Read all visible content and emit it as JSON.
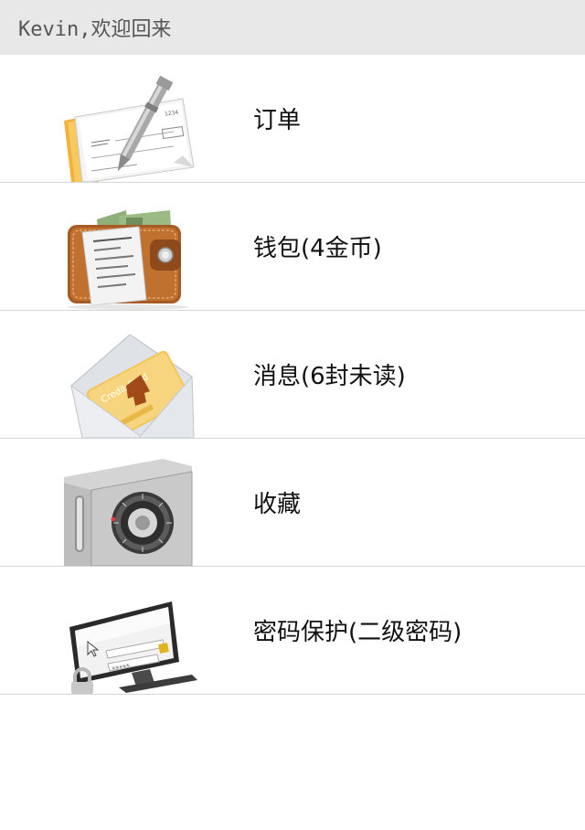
{
  "header": {
    "title": "Kevin,欢迎回来"
  },
  "menu": {
    "items": [
      {
        "label": "订单",
        "icon": "check-order-icon"
      },
      {
        "label": "钱包(4金币)",
        "icon": "wallet-icon"
      },
      {
        "label": "消息(6封未读)",
        "icon": "envelope-icon"
      },
      {
        "label": "收藏",
        "icon": "safe-icon"
      },
      {
        "label": "密码保护(二级密码)",
        "icon": "monitor-lock-icon"
      }
    ]
  },
  "colors": {
    "header_bg": "#e8e8e8",
    "header_text": "#555555",
    "divider": "#d6d6d6",
    "label_text": "#111111"
  }
}
